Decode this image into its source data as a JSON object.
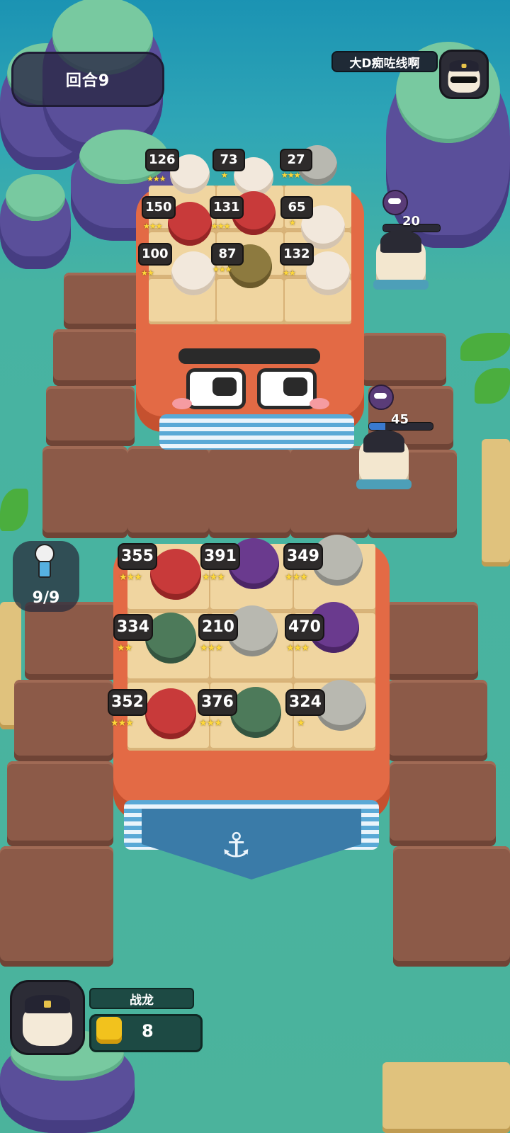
{
  "top_hud": {
    "round_label": "回合9"
  },
  "opponent": {
    "name": "大D痴咗线啊",
    "portrait_icon": "captain-sunglasses-avatar-icon"
  },
  "enemy_captains": [
    {
      "hp": "20",
      "hp_fill_percent": 0
    },
    {
      "hp": "45",
      "hp_fill_percent": 25
    }
  ],
  "opponent_units": [
    {
      "power": "126",
      "stars": 3,
      "kind": "tourist"
    },
    {
      "power": "73",
      "stars": 1,
      "kind": "cream-puff"
    },
    {
      "power": "27",
      "stars": 3,
      "kind": "sword-flag"
    },
    {
      "power": "150",
      "stars": 3,
      "kind": "red-warrior"
    },
    {
      "power": "131",
      "stars": 3,
      "kind": "rooster-king"
    },
    {
      "power": "65",
      "stars": 1,
      "kind": "cream-puff"
    },
    {
      "power": "100",
      "stars": 2,
      "kind": "cream-puff"
    },
    {
      "power": "87",
      "stars": 3,
      "kind": "robot"
    },
    {
      "power": "132",
      "stars": 2,
      "kind": "cream-puff"
    }
  ],
  "player_units": [
    {
      "power": "355",
      "stars": 3,
      "kind": "tourist"
    },
    {
      "power": "391",
      "stars": 3,
      "kind": "purple-penguin"
    },
    {
      "power": "349",
      "stars": 3,
      "kind": "robot-claw"
    },
    {
      "power": "334",
      "stars": 2,
      "kind": "goblin-archer"
    },
    {
      "power": "210",
      "stars": 3,
      "kind": "sword-flag"
    },
    {
      "power": "470",
      "stars": 3,
      "kind": "magician"
    },
    {
      "power": "352",
      "stars": 3,
      "kind": "tourist"
    },
    {
      "power": "376",
      "stars": 3,
      "kind": "goblin-archer"
    },
    {
      "power": "324",
      "stars": 1,
      "kind": "robot-claw"
    }
  ],
  "population": {
    "label": "9/9",
    "icon": "crew-figure-icon"
  },
  "player": {
    "name": "战龙",
    "gold": "8",
    "portrait_icon": "captain-avatar-icon",
    "gold_icon": "gold-coin-icon"
  },
  "colors": {
    "ship": "#e36a45",
    "board": "#f0d5a0",
    "star": "#ffd83a",
    "hp_bar": "#3a7ad0"
  }
}
